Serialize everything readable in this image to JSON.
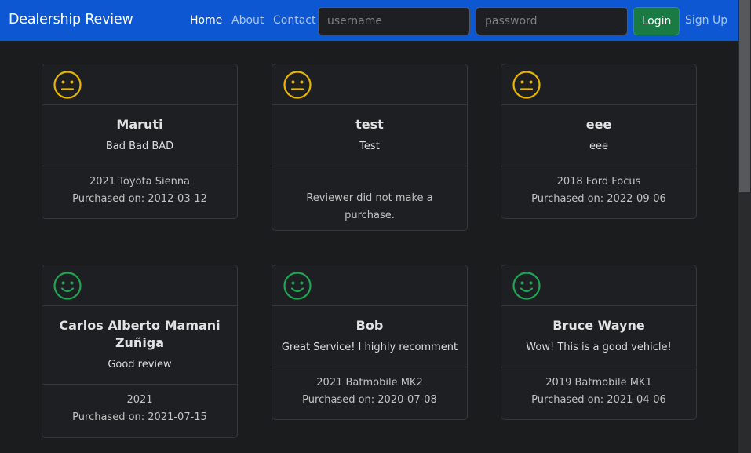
{
  "nav": {
    "brand": "Dealership Review",
    "links": [
      "Home",
      "About",
      "Contact"
    ],
    "username_placeholder": "username",
    "password_placeholder": "password",
    "login_label": "Login",
    "signup_label": "Sign Up"
  },
  "colors": {
    "navbar": "#0d57d3",
    "neutral_icon": "#e8b500",
    "positive_icon": "#1fa552"
  },
  "reviews": [
    {
      "sentiment": "neutral",
      "icon": "neutral-face-icon",
      "name": "Maruti",
      "review": "Bad Bad BAD",
      "car": "2021 Toyota Sienna",
      "purchase": "Purchased on: 2012-03-12"
    },
    {
      "sentiment": "neutral",
      "icon": "neutral-face-icon",
      "name": "test",
      "review": "Test",
      "car": "",
      "purchase": "Reviewer did not make a purchase."
    },
    {
      "sentiment": "neutral",
      "icon": "neutral-face-icon",
      "name": "eee",
      "review": "eee",
      "car": "2018 Ford Focus",
      "purchase": "Purchased on: 2022-09-06"
    },
    {
      "sentiment": "positive",
      "icon": "smiley-face-icon",
      "name": "Carlos Alberto Mamani Zuñiga",
      "review": "Good review",
      "car": "2021",
      "purchase": "Purchased on: 2021-07-15"
    },
    {
      "sentiment": "positive",
      "icon": "smiley-face-icon",
      "name": "Bob",
      "review": "Great Service! I highly recomment",
      "car": "2021 Batmobile MK2",
      "purchase": "Purchased on: 2020-07-08"
    },
    {
      "sentiment": "positive",
      "icon": "smiley-face-icon",
      "name": "Bruce Wayne",
      "review": "Wow! This is a good vehicle!",
      "car": "2019 Batmobile MK1",
      "purchase": "Purchased on: 2021-04-06"
    }
  ]
}
